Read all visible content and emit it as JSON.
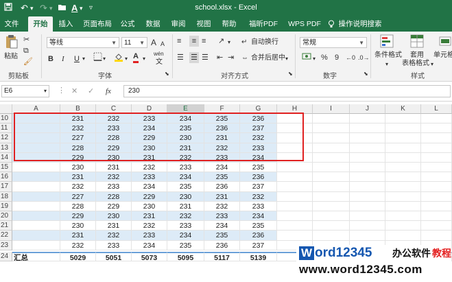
{
  "window": {
    "title": "school.xlsx  -  Excel",
    "qat": {
      "save_icon": "save-icon",
      "undo_icon": "undo-icon",
      "redo_icon": "redo-icon"
    }
  },
  "tabs": [
    "文件",
    "开始",
    "插入",
    "页面布局",
    "公式",
    "数据",
    "审阅",
    "视图",
    "帮助",
    "福昕PDF",
    "WPS PDF",
    "操作说明搜索"
  ],
  "active_tab": "开始",
  "ribbon": {
    "clipboard": {
      "paste": "粘贴",
      "group_label": "剪贴板"
    },
    "font": {
      "name": "等线",
      "size": "11",
      "bold": "B",
      "italic": "I",
      "underline": "U",
      "grow": "A",
      "shrink": "A",
      "wen": "wén",
      "group_label": "字体"
    },
    "alignment": {
      "wrap": "自动换行",
      "merge": "合并后居中",
      "group_label": "对齐方式"
    },
    "number": {
      "format": "常规",
      "percent": "%",
      "comma": "9",
      "group_label": "数字"
    },
    "styles": {
      "conditional": "条件格式",
      "table_line1": "套用",
      "table_line2": "表格格式",
      "cell_styles": "单元格样",
      "group_label": "样式"
    }
  },
  "formula_bar": {
    "name_box": "E6",
    "fx": "fx",
    "value": "230"
  },
  "columns": [
    "A",
    "B",
    "C",
    "D",
    "E",
    "F",
    "G",
    "H",
    "I",
    "J",
    "K",
    "L"
  ],
  "selected_column": "E",
  "rows": [
    {
      "num": "10",
      "vals": [
        "231",
        "232",
        "233",
        "234",
        "235",
        "236"
      ]
    },
    {
      "num": "11",
      "vals": [
        "232",
        "233",
        "234",
        "235",
        "236",
        "237"
      ]
    },
    {
      "num": "12",
      "vals": [
        "227",
        "228",
        "229",
        "230",
        "231",
        "232"
      ]
    },
    {
      "num": "13",
      "vals": [
        "228",
        "229",
        "230",
        "231",
        "232",
        "233"
      ]
    },
    {
      "num": "14",
      "vals": [
        "229",
        "230",
        "231",
        "232",
        "233",
        "234"
      ]
    },
    {
      "num": "15",
      "vals": [
        "230",
        "231",
        "232",
        "233",
        "234",
        "235"
      ]
    },
    {
      "num": "16",
      "vals": [
        "231",
        "232",
        "233",
        "234",
        "235",
        "236"
      ]
    },
    {
      "num": "17",
      "vals": [
        "232",
        "233",
        "234",
        "235",
        "236",
        "237"
      ]
    },
    {
      "num": "18",
      "vals": [
        "227",
        "228",
        "229",
        "230",
        "231",
        "232"
      ]
    },
    {
      "num": "19",
      "vals": [
        "228",
        "229",
        "230",
        "231",
        "232",
        "233"
      ]
    },
    {
      "num": "20",
      "vals": [
        "229",
        "230",
        "231",
        "232",
        "233",
        "234"
      ]
    },
    {
      "num": "21",
      "vals": [
        "230",
        "231",
        "232",
        "233",
        "234",
        "235"
      ]
    },
    {
      "num": "22",
      "vals": [
        "231",
        "232",
        "233",
        "234",
        "235",
        "236"
      ]
    },
    {
      "num": "23",
      "vals": [
        "232",
        "233",
        "234",
        "235",
        "236",
        "237"
      ]
    }
  ],
  "total_row": {
    "num": "24",
    "label": "汇总",
    "vals": [
      "5029",
      "5051",
      "5073",
      "5095",
      "5117",
      "5139"
    ]
  },
  "watermark": {
    "logo": "W",
    "brand": "ord12345",
    "cn1": "办公软件",
    "cn2": "教程",
    "url": "www.word12345.com"
  }
}
